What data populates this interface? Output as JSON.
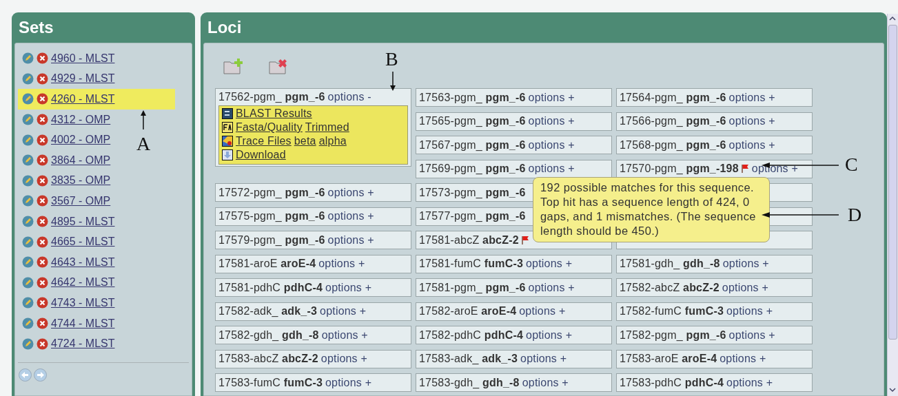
{
  "sets": {
    "title": "Sets",
    "items": [
      {
        "label": "4960 - MLST",
        "selected": false
      },
      {
        "label": "4929 - MLST",
        "selected": false
      },
      {
        "label": "4260 - MLST",
        "selected": true
      },
      {
        "label": "4312 - OMP",
        "selected": false
      },
      {
        "label": "4002 - OMP",
        "selected": false
      },
      {
        "label": "3864 - OMP",
        "selected": false
      },
      {
        "label": "3835 - OMP",
        "selected": false
      },
      {
        "label": "3567 - OMP",
        "selected": false
      },
      {
        "label": "4895 - MLST",
        "selected": false
      },
      {
        "label": "4665 - MLST",
        "selected": false
      },
      {
        "label": "4643 - MLST",
        "selected": false
      },
      {
        "label": "4642 - MLST",
        "selected": false
      },
      {
        "label": "4743 - MLST",
        "selected": false
      },
      {
        "label": "4744 - MLST",
        "selected": false
      },
      {
        "label": "4724 - MLST",
        "selected": false
      }
    ]
  },
  "loci": {
    "title": "Loci",
    "cells": [
      {
        "label": "17562-pgm_ **pgm_-6**",
        "options": "options -",
        "flagged": false,
        "expanded": true,
        "menu": [
          {
            "kind": "blast",
            "links": [
              "BLAST Results"
            ]
          },
          {
            "kind": "fasta",
            "links": [
              "Fasta/Quality",
              "Trimmed"
            ]
          },
          {
            "kind": "trace",
            "links": [
              "Trace Files",
              "beta",
              "alpha"
            ]
          },
          {
            "kind": "download",
            "links": [
              "Download"
            ]
          }
        ]
      },
      {
        "label": "17563-pgm_ **pgm_-6**",
        "options": "options +",
        "flagged": false,
        "expanded": false
      },
      {
        "label": "17564-pgm_ **pgm_-6**",
        "options": "options +",
        "flagged": false,
        "expanded": false
      },
      {
        "label": "17565-pgm_ **pgm_-6**",
        "options": "options +",
        "flagged": false,
        "expanded": false
      },
      {
        "label": "17566-pgm_ **pgm_-6**",
        "options": "options +",
        "flagged": false,
        "expanded": false
      },
      {
        "label": "17567-pgm_ **pgm_-6**",
        "options": "options +",
        "flagged": false,
        "expanded": false
      },
      {
        "label": "17568-pgm_ **pgm_-6**",
        "options": "options +",
        "flagged": false,
        "expanded": false
      },
      {
        "label": "17569-pgm_ **pgm_-6**",
        "options": "options +",
        "flagged": false,
        "expanded": false
      },
      {
        "label": "17570-pgm_ **pgm_-198**",
        "options": "options +",
        "flagged": true,
        "expanded": false
      },
      {
        "label": "17572-pgm_ **pgm_-6**",
        "options": "options +",
        "flagged": false,
        "expanded": false
      },
      {
        "label": "17573-pgm_ **pgm_-6**",
        "flagged": false,
        "expanded": false
      },
      {},
      {
        "label": "17575-pgm_ **pgm_-6**",
        "options": "options +",
        "flagged": false,
        "expanded": false
      },
      {
        "label": "17577-pgm_ **pgm_-6**",
        "flagged": false,
        "expanded": false
      },
      {},
      {
        "label": "17579-pgm_ **pgm_-6**",
        "options": "options +",
        "flagged": false,
        "expanded": false
      },
      {
        "label": "17581-abcZ **abcZ-2**",
        "flagged": true,
        "expanded": false
      },
      {},
      {
        "label": "17581-aroE **aroE-4**",
        "options": "options +",
        "flagged": false,
        "expanded": false
      },
      {
        "label": "17581-fumC **fumC-3**",
        "options": "options +",
        "flagged": false,
        "expanded": false
      },
      {
        "label": "17581-gdh_ **gdh_-8**",
        "options": "options +",
        "flagged": false,
        "expanded": false
      },
      {
        "label": "17581-pdhC **pdhC-4**",
        "options": "options +",
        "flagged": false,
        "expanded": false
      },
      {
        "label": "17581-pgm_ **pgm_-6**",
        "options": "options +",
        "flagged": false,
        "expanded": false
      },
      {
        "label": "17582-abcZ **abcZ-2**",
        "options": "options +",
        "flagged": false,
        "expanded": false
      },
      {
        "label": "17582-adk_ **adk_-3**",
        "options": "options +",
        "flagged": false,
        "expanded": false
      },
      {
        "label": "17582-aroE **aroE-4**",
        "options": "options +",
        "flagged": false,
        "expanded": false
      },
      {
        "label": "17582-fumC **fumC-3**",
        "options": "options +",
        "flagged": false,
        "expanded": false
      },
      {
        "label": "17582-gdh_ **gdh_-8**",
        "options": "options +",
        "flagged": false,
        "expanded": false
      },
      {
        "label": "17582-pdhC **pdhC-4**",
        "options": "options +",
        "flagged": false,
        "expanded": false
      },
      {
        "label": "17582-pgm_ **pgm_-6**",
        "options": "options +",
        "flagged": false,
        "expanded": false
      },
      {
        "label": "17583-abcZ **abcZ-2**",
        "options": "options +",
        "flagged": false,
        "expanded": false
      },
      {
        "label": "17583-adk_ **adk_-3**",
        "options": "options +",
        "flagged": false,
        "expanded": false
      },
      {
        "label": "17583-aroE **aroE-4**",
        "options": "options +",
        "flagged": false,
        "expanded": false
      },
      {
        "label": "17583-fumC **fumC-3**",
        "options": "options +",
        "flagged": false,
        "expanded": false
      },
      {
        "label": "17583-gdh_ **gdh_-8**",
        "options": "options +",
        "flagged": false,
        "expanded": false
      },
      {
        "label": "17583-pdhC **pdhC-4**",
        "options": "options +",
        "flagged": false,
        "expanded": false
      }
    ],
    "tooltip": "192 possible matches for this sequence. Top hit has a sequence length of 424, 0 gaps, and 1 mismatches. (The sequence length should be 450.)"
  },
  "annotations": [
    {
      "letter": "A",
      "kind": "up"
    },
    {
      "letter": "B",
      "kind": "down"
    },
    {
      "letter": "C",
      "kind": "left"
    },
    {
      "letter": "D",
      "kind": "left"
    }
  ]
}
